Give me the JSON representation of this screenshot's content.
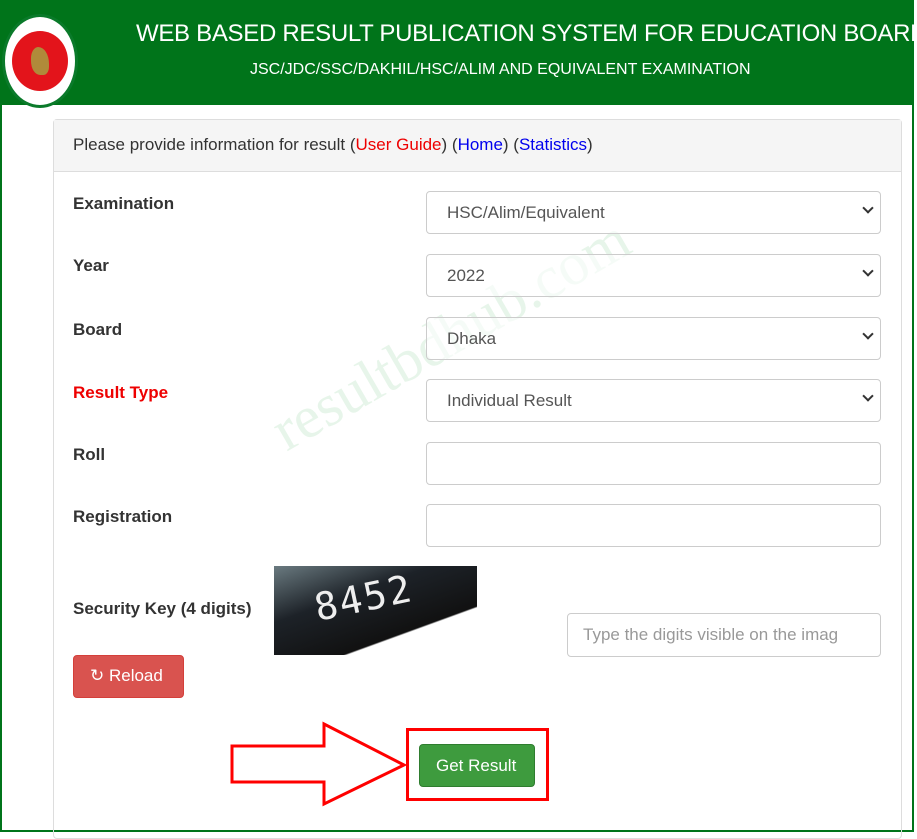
{
  "header": {
    "title": "WEB BASED RESULT PUBLICATION SYSTEM FOR EDUCATION BOARDS",
    "subtitle": "JSC/JDC/SSC/DAKHIL/HSC/ALIM AND EQUIVALENT EXAMINATION"
  },
  "panel": {
    "intro": "Please provide information for result (",
    "user_guide": "User Guide",
    "sep1": ") (",
    "home": "Home",
    "sep2": ") (",
    "statistics": "Statistics",
    "close": ")"
  },
  "form": {
    "examination": {
      "label": "Examination",
      "value": "HSC/Alim/Equivalent"
    },
    "year": {
      "label": "Year",
      "value": "2022"
    },
    "board": {
      "label": "Board",
      "value": "Dhaka"
    },
    "result_type": {
      "label": "Result Type",
      "value": "Individual Result"
    },
    "roll": {
      "label": "Roll",
      "value": ""
    },
    "registration": {
      "label": "Registration",
      "value": ""
    },
    "security_key": {
      "label": "Security Key (4 digits)",
      "captcha_digits": "8452",
      "placeholder": "Type the digits visible on the imag"
    },
    "reload_label": "Reload",
    "submit_label": "Get Result"
  },
  "watermark": "resultbdhub.com",
  "colors": {
    "header_bg": "#00741a",
    "reload": "#d9534f",
    "submit": "#3e9b3e",
    "highlight": "#ff0000"
  }
}
